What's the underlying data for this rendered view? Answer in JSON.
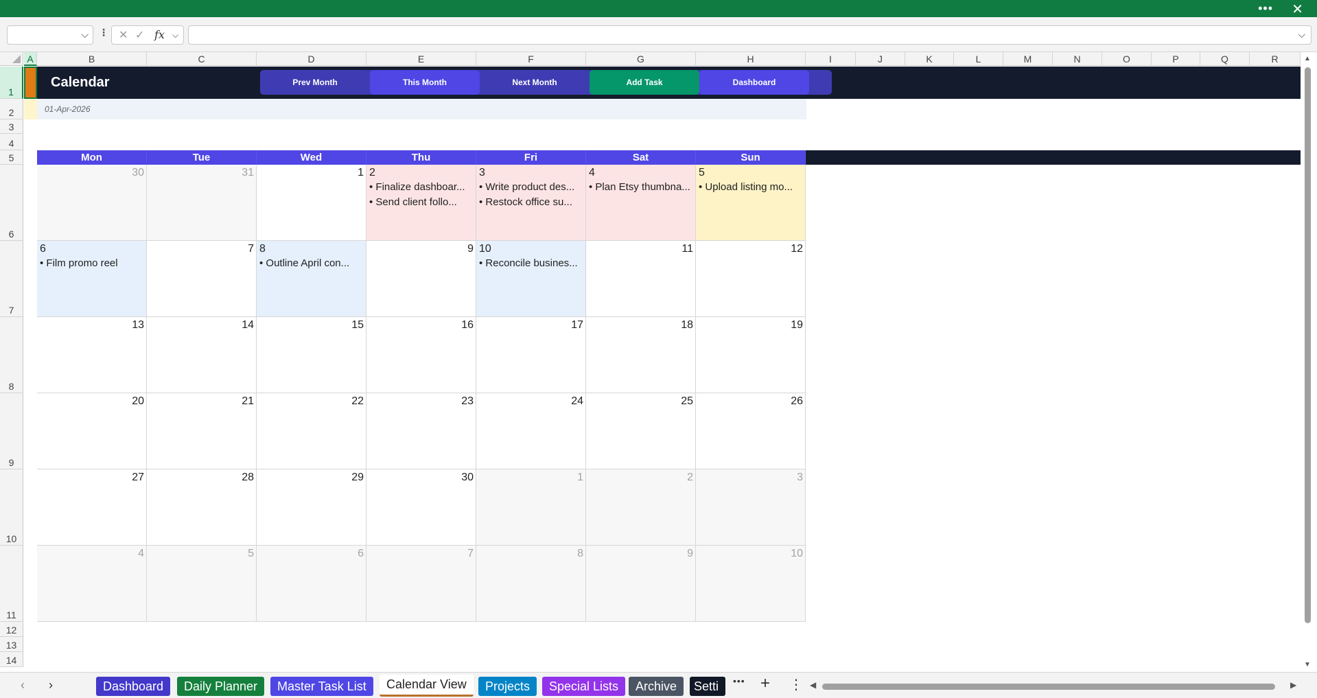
{
  "titlebar": {
    "more": "•••",
    "close": "✕"
  },
  "formula_bar": {
    "fx": "fx",
    "cancel": "✕",
    "enter": "✓",
    "name_box_value": "",
    "formula_value": ""
  },
  "columns": [
    "A",
    "B",
    "C",
    "D",
    "E",
    "F",
    "G",
    "H",
    "I",
    "J",
    "K",
    "L",
    "M",
    "N",
    "O",
    "P",
    "Q",
    "R"
  ],
  "rows": [
    "1",
    "2",
    "3",
    "4",
    "5",
    "6",
    "7",
    "8",
    "9",
    "10",
    "11",
    "12",
    "13",
    "14"
  ],
  "sheet": {
    "title": "Calendar",
    "date": "01-Apr-2026",
    "buttons": [
      {
        "label": "Prev Month",
        "color": "#3f3cb3"
      },
      {
        "label": "This Month",
        "color": "#4f46e5"
      },
      {
        "label": "Next Month",
        "color": "#3f3cb3"
      },
      {
        "label": "Add Task",
        "color": "#059669"
      },
      {
        "label": "Dashboard",
        "color": "#4f46e5"
      }
    ],
    "days": [
      "Mon",
      "Tue",
      "Wed",
      "Thu",
      "Fri",
      "Sat",
      "Sun"
    ]
  },
  "calendar": {
    "weeks": [
      [
        {
          "day": "30",
          "muted": true,
          "tasks": []
        },
        {
          "day": "31",
          "muted": true,
          "tasks": []
        },
        {
          "day": "1",
          "tasks": []
        },
        {
          "day": "2",
          "color": "#fde4e4",
          "tasks": [
            "• Finalize dashboar...",
            "• Send client follo..."
          ]
        },
        {
          "day": "3",
          "color": "#fde4e4",
          "tasks": [
            "• Write product des...",
            "• Restock office su..."
          ]
        },
        {
          "day": "4",
          "color": "#fde4e4",
          "tasks": [
            "• Plan Etsy thumbna..."
          ]
        },
        {
          "day": "5",
          "color": "#fdf3c7",
          "tasks": [
            "• Upload listing mo..."
          ]
        }
      ],
      [
        {
          "day": "6",
          "color": "#e6f0fc",
          "tasks": [
            "• Film promo reel"
          ]
        },
        {
          "day": "7",
          "tasks": []
        },
        {
          "day": "8",
          "color": "#e6f0fc",
          "tasks": [
            "• Outline April con..."
          ]
        },
        {
          "day": "9",
          "tasks": []
        },
        {
          "day": "10",
          "color": "#e6f0fc",
          "tasks": [
            "• Reconcile busines..."
          ]
        },
        {
          "day": "11",
          "tasks": []
        },
        {
          "day": "12",
          "tasks": []
        }
      ],
      [
        {
          "day": "13",
          "tasks": []
        },
        {
          "day": "14",
          "tasks": []
        },
        {
          "day": "15",
          "tasks": []
        },
        {
          "day": "16",
          "tasks": []
        },
        {
          "day": "17",
          "tasks": []
        },
        {
          "day": "18",
          "tasks": []
        },
        {
          "day": "19",
          "tasks": []
        }
      ],
      [
        {
          "day": "20",
          "tasks": []
        },
        {
          "day": "21",
          "tasks": []
        },
        {
          "day": "22",
          "tasks": []
        },
        {
          "day": "23",
          "tasks": []
        },
        {
          "day": "24",
          "tasks": []
        },
        {
          "day": "25",
          "tasks": []
        },
        {
          "day": "26",
          "tasks": []
        }
      ],
      [
        {
          "day": "27",
          "tasks": []
        },
        {
          "day": "28",
          "tasks": []
        },
        {
          "day": "29",
          "tasks": []
        },
        {
          "day": "30",
          "tasks": []
        },
        {
          "day": "1",
          "muted": true,
          "tasks": []
        },
        {
          "day": "2",
          "muted": true,
          "tasks": []
        },
        {
          "day": "3",
          "muted": true,
          "tasks": []
        }
      ],
      [
        {
          "day": "4",
          "muted": true,
          "tasks": []
        },
        {
          "day": "5",
          "muted": true,
          "tasks": []
        },
        {
          "day": "6",
          "muted": true,
          "tasks": []
        },
        {
          "day": "7",
          "muted": true,
          "tasks": []
        },
        {
          "day": "8",
          "muted": true,
          "tasks": []
        },
        {
          "day": "9",
          "muted": true,
          "tasks": []
        },
        {
          "day": "10",
          "muted": true,
          "tasks": []
        }
      ]
    ]
  },
  "tabs": {
    "prev": "‹",
    "next": "›",
    "items": [
      {
        "label": "Dashboard",
        "color": "#4338ca"
      },
      {
        "label": "Daily Planner",
        "color": "#15803d"
      },
      {
        "label": "Master Task List",
        "color": "#4f46e5"
      },
      {
        "label": "Calendar View",
        "color": "#ffffff",
        "active": true
      },
      {
        "label": "Projects",
        "color": "#0284c7"
      },
      {
        "label": "Special Lists",
        "color": "#9333ea"
      },
      {
        "label": "Archive",
        "color": "#4b5563"
      },
      {
        "label": "Setti",
        "color": "#111827"
      }
    ],
    "more": "•••",
    "add": "+",
    "menu": "⋮"
  }
}
